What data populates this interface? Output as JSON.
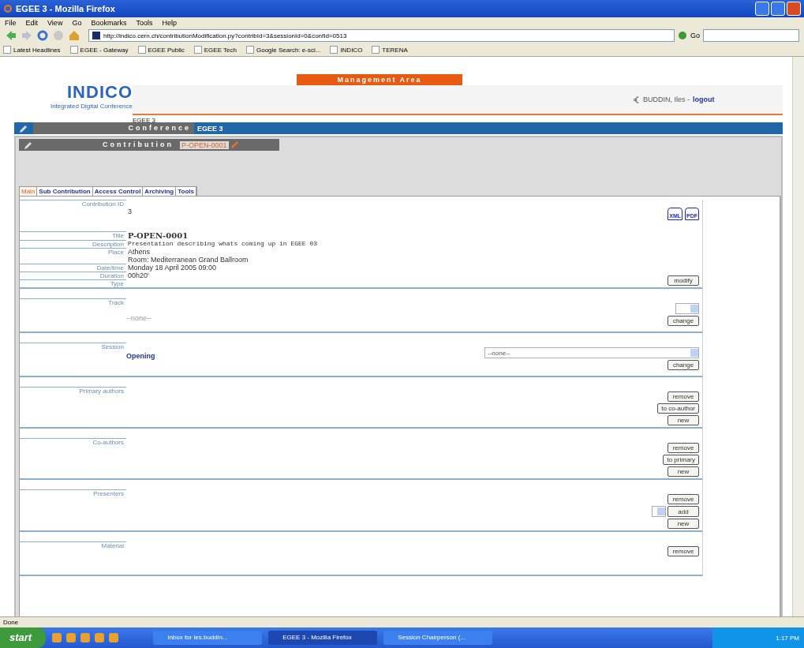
{
  "window": {
    "title": "EGEE 3 - Mozilla Firefox"
  },
  "menu": [
    "File",
    "Edit",
    "View",
    "Go",
    "Bookmarks",
    "Tools",
    "Help"
  ],
  "address": {
    "value": "http://indico.cern.ch/contributionModification.py?contribId=3&sessionId=0&confId=0513",
    "go": "Go"
  },
  "bookmarks": [
    "Latest Headlines",
    "EGEE - Gateway",
    "EGEE Public",
    "EGEE Tech",
    "Google Search: e-sci...",
    "INDICO",
    "TERENA"
  ],
  "header": {
    "logo": "INDICO",
    "tagline": "Integrated Digital Conference",
    "area": "Management Area",
    "user": "BUDDIN, Iles -",
    "logout": "logout",
    "breadcrumb": "EGEE 3"
  },
  "conference": {
    "label": "Conference",
    "value": "EGEE 3"
  },
  "contribution": {
    "label": "Contribution",
    "value": "P-OPEN-0001"
  },
  "tabs": [
    {
      "label": "Main",
      "selected": true
    },
    {
      "label": "Sub Contribution",
      "selected": false
    },
    {
      "label": "Access Control",
      "selected": false
    },
    {
      "label": "Archiving",
      "selected": false
    },
    {
      "label": "Tools",
      "selected": false
    }
  ],
  "export": [
    "XML",
    "PDF"
  ],
  "fields": [
    {
      "label": "Contribution ID",
      "value": "3",
      "kind": "plain"
    },
    {
      "label": "Title",
      "value": "P-OPEN-0001",
      "kind": "bold"
    },
    {
      "label": "Description",
      "value": "Presentation describing whats coming up in EGEE 03",
      "kind": "mono"
    },
    {
      "label": "Place",
      "value": "Athens",
      "value2": "Room: Mediterranean Grand Ballroom",
      "kind": "plain"
    },
    {
      "label": "Date/time",
      "value": "Monday 18 April 2005 09:00",
      "kind": "plain"
    },
    {
      "label": "Duration",
      "value": "00h20'",
      "kind": "plain"
    },
    {
      "label": "Type"
    }
  ],
  "modify": "modify",
  "sections": [
    {
      "label": "Track",
      "value": "--none--",
      "kind": "muted",
      "controls": [
        {
          "kind": "select"
        },
        {
          "kind": "button",
          "label": "change"
        }
      ]
    },
    {
      "label": "Session",
      "value": "Opening",
      "kind": "link",
      "controls": [
        {
          "kind": "wide-select",
          "label": "--none--"
        },
        {
          "kind": "button",
          "label": "change"
        }
      ]
    },
    {
      "label": "Primary authors",
      "controls": [
        {
          "kind": "button",
          "label": "remove"
        },
        {
          "kind": "button",
          "label": "to co-author"
        },
        {
          "kind": "button",
          "label": "new"
        }
      ]
    },
    {
      "label": "Co-authors",
      "controls": [
        {
          "kind": "button",
          "label": "remove"
        },
        {
          "kind": "button",
          "label": "to primary"
        },
        {
          "kind": "button",
          "label": "new"
        }
      ]
    },
    {
      "label": "Presenters",
      "controls": [
        {
          "kind": "button",
          "label": "remove"
        },
        {
          "kind": "select-add",
          "label": "add"
        },
        {
          "kind": "button",
          "label": "new"
        }
      ]
    },
    {
      "label": "Material",
      "controls": [
        {
          "kind": "button",
          "label": "remove"
        }
      ]
    }
  ],
  "status_bar": "Done",
  "taskbar": {
    "start": "start",
    "tasks": [
      {
        "label": "Inbox for les.buddin...",
        "selected": false
      },
      {
        "label": "EGEE 3 - Mozilla Firefox",
        "selected": true
      },
      {
        "label": "Session Chairperson (...",
        "selected": false
      }
    ],
    "clock": "1:17 PM"
  }
}
